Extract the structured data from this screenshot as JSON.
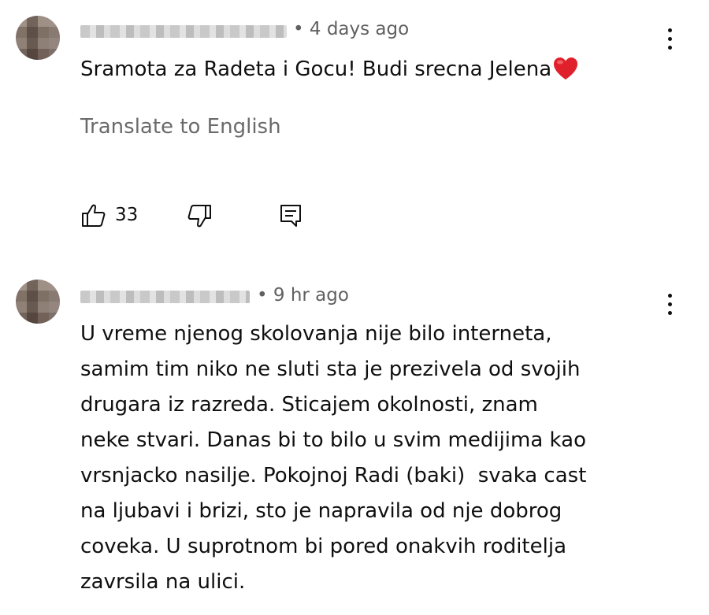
{
  "comments": [
    {
      "time": "• 4 days ago",
      "text": "Sramota za Radeta i Gocu! Budi srecna Jelena",
      "translate": "Translate to English",
      "likes": "33",
      "icons": [
        "thumb-up-icon",
        "thumb-down-icon",
        "reply-icon",
        "more-vert-icon",
        "heart-emoji"
      ]
    },
    {
      "time": "• 9 hr ago",
      "lines": [
        "U vreme njenog skolovanja nije bilo interneta,",
        "samim tim niko ne sluti sta je prezivela od svojih",
        "drugara iz razreda. Sticajem okolnosti, znam",
        "neke stvari. Danas bi to bilo u svim medijima kao",
        "vrsnjacko nasilje. Pokojnoj Radi (baki)  svaka cast",
        "na ljubavi i brizi, sto je napravila od nje dobrog",
        "coveka. U suprotnom bi pored onakvih roditelja",
        "zavrsila na ulici."
      ],
      "icons": [
        "more-vert-icon"
      ]
    }
  ],
  "colors": {
    "text": "#0f0f0f",
    "meta": "#606060",
    "heart": "#e0202a"
  }
}
